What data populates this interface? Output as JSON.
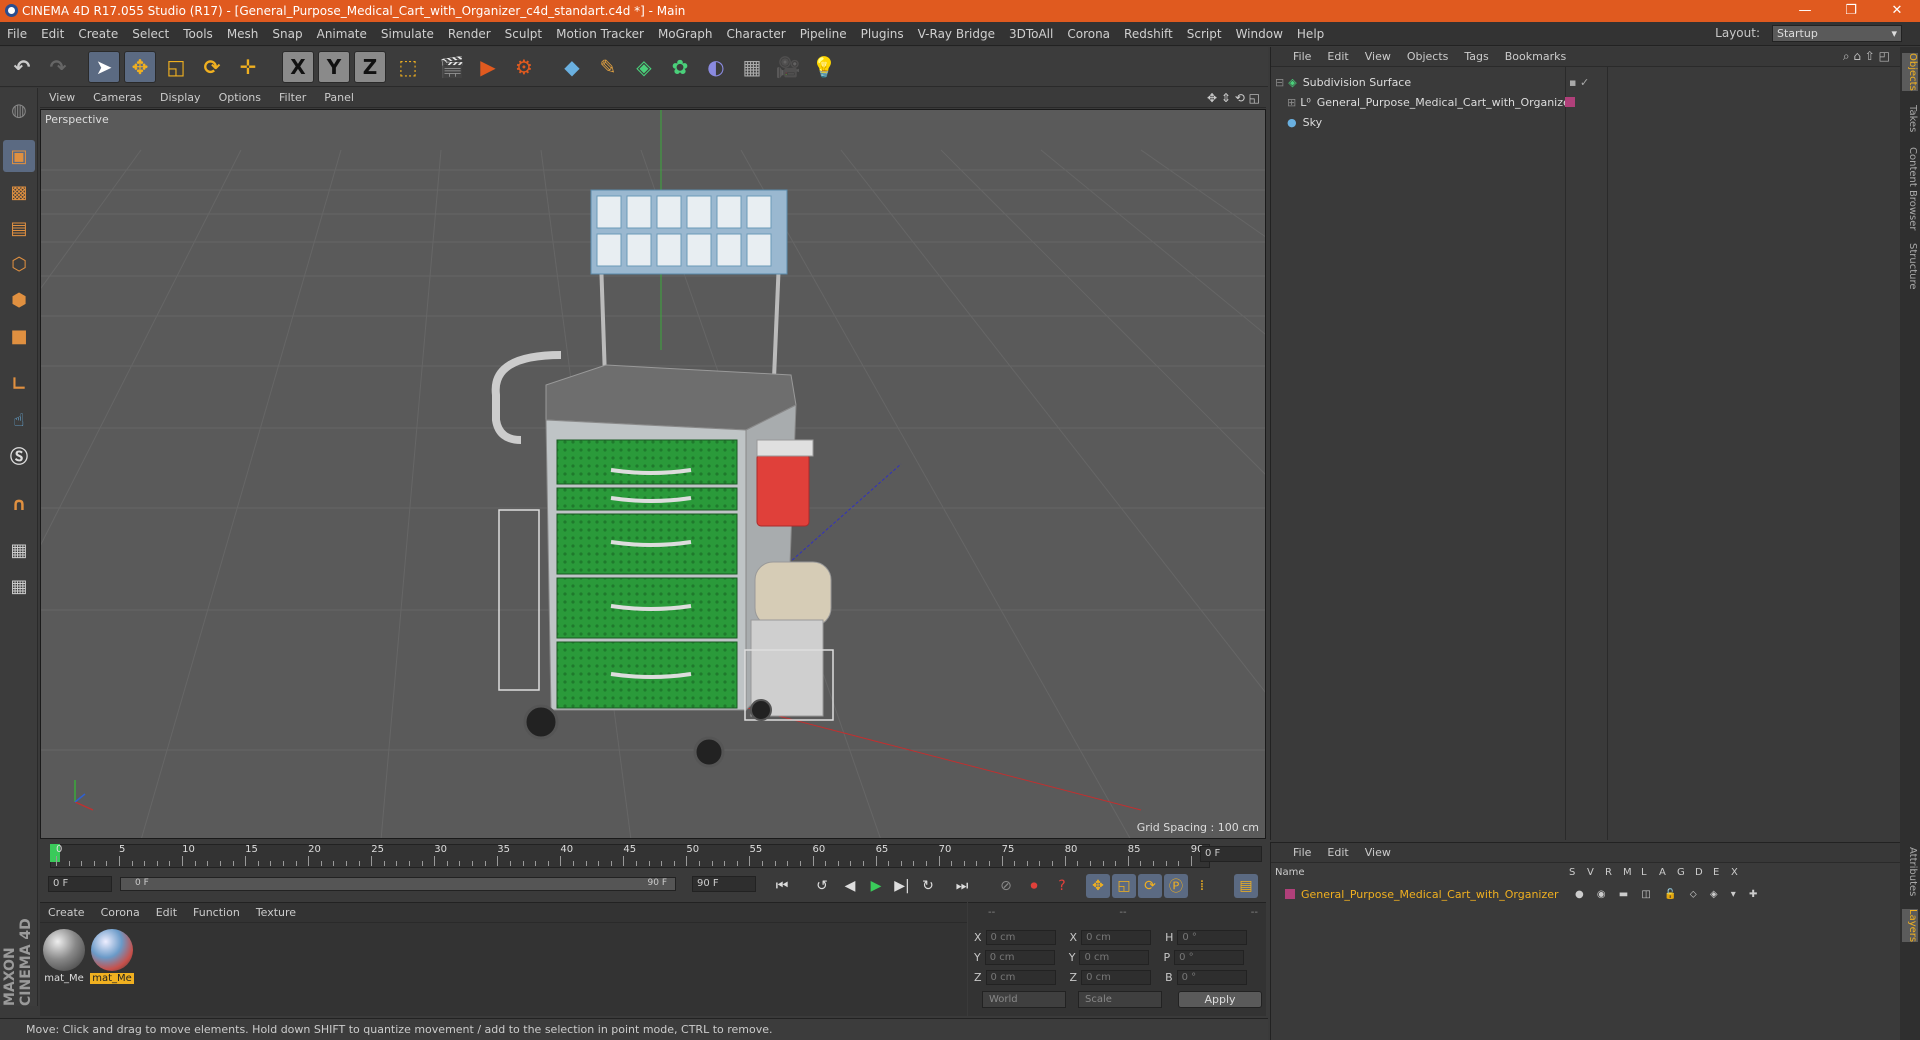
{
  "window": {
    "title": "CINEMA 4D R17.055 Studio (R17) - [General_Purpose_Medical_Cart_with_Organizer_c4d_standart.c4d *] - Main",
    "controls": [
      "—",
      "❐",
      "✕"
    ]
  },
  "menubar": {
    "items": [
      "File",
      "Edit",
      "Create",
      "Select",
      "Tools",
      "Mesh",
      "Snap",
      "Animate",
      "Simulate",
      "Render",
      "Sculpt",
      "Motion Tracker",
      "MoGraph",
      "Character",
      "Pipeline",
      "Plugins",
      "V-Ray Bridge",
      "3DToAll",
      "Corona",
      "Redshift",
      "Script",
      "Window",
      "Help"
    ],
    "layout_label": "Layout:",
    "layout_value": "Startup"
  },
  "toolbar": {
    "icons": [
      "undo-icon",
      "redo-icon",
      "select-arrow-icon",
      "move-icon",
      "scale-icon",
      "rotate-icon",
      "last-tool-icon",
      "x-axis-icon",
      "y-axis-icon",
      "z-axis-icon",
      "coord-system-icon",
      "render-view-icon",
      "render-picture-viewer-icon",
      "render-settings-icon",
      "cube-icon",
      "pen-icon",
      "subdivision-icon",
      "array-icon",
      "deformer-icon",
      "floor-icon",
      "camera-icon",
      "light-icon"
    ],
    "axis_labels": [
      "X",
      "Y",
      "Z"
    ]
  },
  "viewport": {
    "menu": [
      "View",
      "Cameras",
      "Display",
      "Options",
      "Filter",
      "Panel"
    ],
    "label": "Perspective",
    "grid_spacing": "Grid Spacing : 100 cm"
  },
  "timeline": {
    "ruler_numbers": [
      "0",
      "5",
      "10",
      "15",
      "20",
      "25",
      "30",
      "35",
      "40",
      "45",
      "50",
      "55",
      "60",
      "65",
      "70",
      "75",
      "80",
      "85",
      "90"
    ],
    "current_frame": "0 F",
    "start_frame": "0 F",
    "range_start": "0 F",
    "range_end": "90 F",
    "end_frame": "90 F"
  },
  "materials": {
    "menu": [
      "Create",
      "Corona",
      "Edit",
      "Function",
      "Texture"
    ],
    "items": [
      {
        "name": "mat_Me",
        "selected": false,
        "color": "#8a8a8a"
      },
      {
        "name": "mat_Me",
        "selected": true,
        "color": "#c8504a"
      }
    ]
  },
  "coordinates": {
    "header": [
      "--",
      "--",
      "--"
    ],
    "rows": [
      {
        "a": "X",
        "av": "0 cm",
        "b": "X",
        "bv": "0 cm",
        "c": "H",
        "cv": "0 °"
      },
      {
        "a": "Y",
        "av": "0 cm",
        "b": "Y",
        "bv": "0 cm",
        "c": "P",
        "cv": "0 °"
      },
      {
        "a": "Z",
        "av": "0 cm",
        "b": "Z",
        "bv": "0 cm",
        "c": "B",
        "cv": "0 °"
      }
    ],
    "world": "World",
    "scale": "Scale",
    "apply": "Apply"
  },
  "status": "Move: Click and drag to move elements. Hold down SHIFT to quantize movement / add to the selection in point mode, CTRL to remove.",
  "object_manager": {
    "menu": [
      "File",
      "Edit",
      "View",
      "Objects",
      "Tags",
      "Bookmarks"
    ],
    "objects": [
      {
        "name": "Subdivision Surface",
        "icon": "subdivision-icon"
      },
      {
        "name": "General_Purpose_Medical_Cart_with_Organizer",
        "icon": "null-icon"
      },
      {
        "name": "Sky",
        "icon": "sky-icon"
      }
    ]
  },
  "layer_manager": {
    "menu": [
      "File",
      "Edit",
      "View"
    ],
    "columns": [
      "Name",
      "S",
      "V",
      "R",
      "M",
      "L",
      "A",
      "G",
      "D",
      "E",
      "X"
    ],
    "layers": [
      {
        "name": "General_Purpose_Medical_Cart_with_Organizer",
        "color": "#b0407a"
      }
    ]
  },
  "side_tabs_top": [
    "Objects",
    "Takes",
    "Content Browser",
    "Structure"
  ],
  "side_tabs_bottom": [
    "Attributes",
    "Layers"
  ],
  "brand": "MAXON CINEMA 4D"
}
